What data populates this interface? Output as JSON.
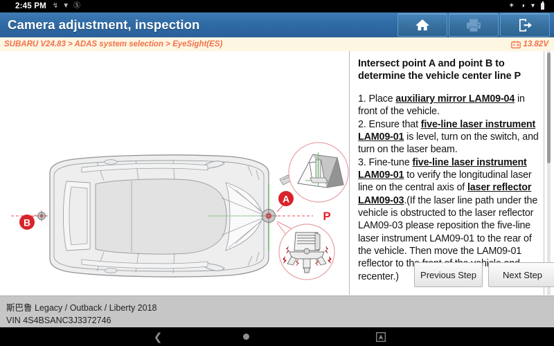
{
  "statusbar": {
    "time": "2:45 PM",
    "left_icons": [
      "usb-debug-icon",
      "vpn-icon",
      "do-not-disturb-icon"
    ],
    "right_icons": [
      "bluetooth-icon",
      "volume-icon",
      "wifi-icon",
      "battery-icon"
    ]
  },
  "header": {
    "title": "Camera adjustment, inspection",
    "buttons": [
      {
        "name": "home-button",
        "icon": "home-icon"
      },
      {
        "name": "print-button",
        "icon": "printer-icon"
      },
      {
        "name": "exit-button",
        "icon": "exit-icon"
      }
    ]
  },
  "breadcrumb": {
    "path": "SUBARU V24.83 > ADAS system selection > EyeSight(ES)",
    "battery_icon": "car-battery-icon",
    "voltage": "13.82V",
    "accent_color": "#f4714a",
    "background_color": "#fdf6e3"
  },
  "diagram": {
    "labels": {
      "point_a": "A",
      "point_b": "B",
      "center_line": "P"
    },
    "markers": [
      {
        "name": "point-a-marker",
        "label": "A"
      },
      {
        "name": "point-b-marker",
        "label": "B"
      },
      {
        "name": "center-line-label",
        "label": "P"
      }
    ],
    "callouts": [
      {
        "name": "auxiliary-mirror-callout",
        "depicts": "auxiliary mirror LAM09-04"
      },
      {
        "name": "laser-instrument-callout",
        "depicts": "five-line laser instrument tripod adjustment"
      }
    ],
    "colors": {
      "laser_line": "#e8606a",
      "vertical_laser": "#7ac07a",
      "marker_fill": "#d8232a",
      "vehicle_outline": "#8a8f96"
    }
  },
  "instructions": {
    "heading": "Intersect point A and point B to determine the vehicle center line P",
    "steps": [
      {
        "number": "1. ",
        "segments": [
          {
            "text": "Place ",
            "bold": false
          },
          {
            "text": "auxiliary mirror LAM09-04",
            "bold": true
          },
          {
            "text": " in front of the vehicle.",
            "bold": false
          }
        ]
      },
      {
        "number": "2. ",
        "segments": [
          {
            "text": "Ensure that ",
            "bold": false
          },
          {
            "text": "five-line laser instrument LAM09-01",
            "bold": true
          },
          {
            "text": " is level, turn on the switch, and turn on the laser beam.",
            "bold": false
          }
        ]
      },
      {
        "number": "3. ",
        "segments": [
          {
            "text": "Fine-tune ",
            "bold": false
          },
          {
            "text": "five-line laser instrument LAM09-01",
            "bold": true
          },
          {
            "text": " to verify the longitudinal laser line on the central axis of ",
            "bold": false
          },
          {
            "text": "laser reflector LAM09-03",
            "bold": true
          },
          {
            "text": ".(If the laser line path under the vehicle is obstructed to the laser reflector LAM09-03 please reposition the five-line laser instrument LAM09-01 to the rear of the vehicle. Then move the LAM09-01 reflector to the front of the vehicle and recenter.)",
            "bold": false
          }
        ]
      }
    ]
  },
  "actions": {
    "previous_step": "Previous Step",
    "next_step": "Next Step"
  },
  "footer": {
    "vehicle": "斯巴鲁 Legacy / Outback / Liberty 2018",
    "vin": "VIN 4S4BSANC3J3372746"
  },
  "navbar": {
    "back": "back-icon",
    "home": "home-circle-icon",
    "recent": "recent-apps-icon"
  }
}
